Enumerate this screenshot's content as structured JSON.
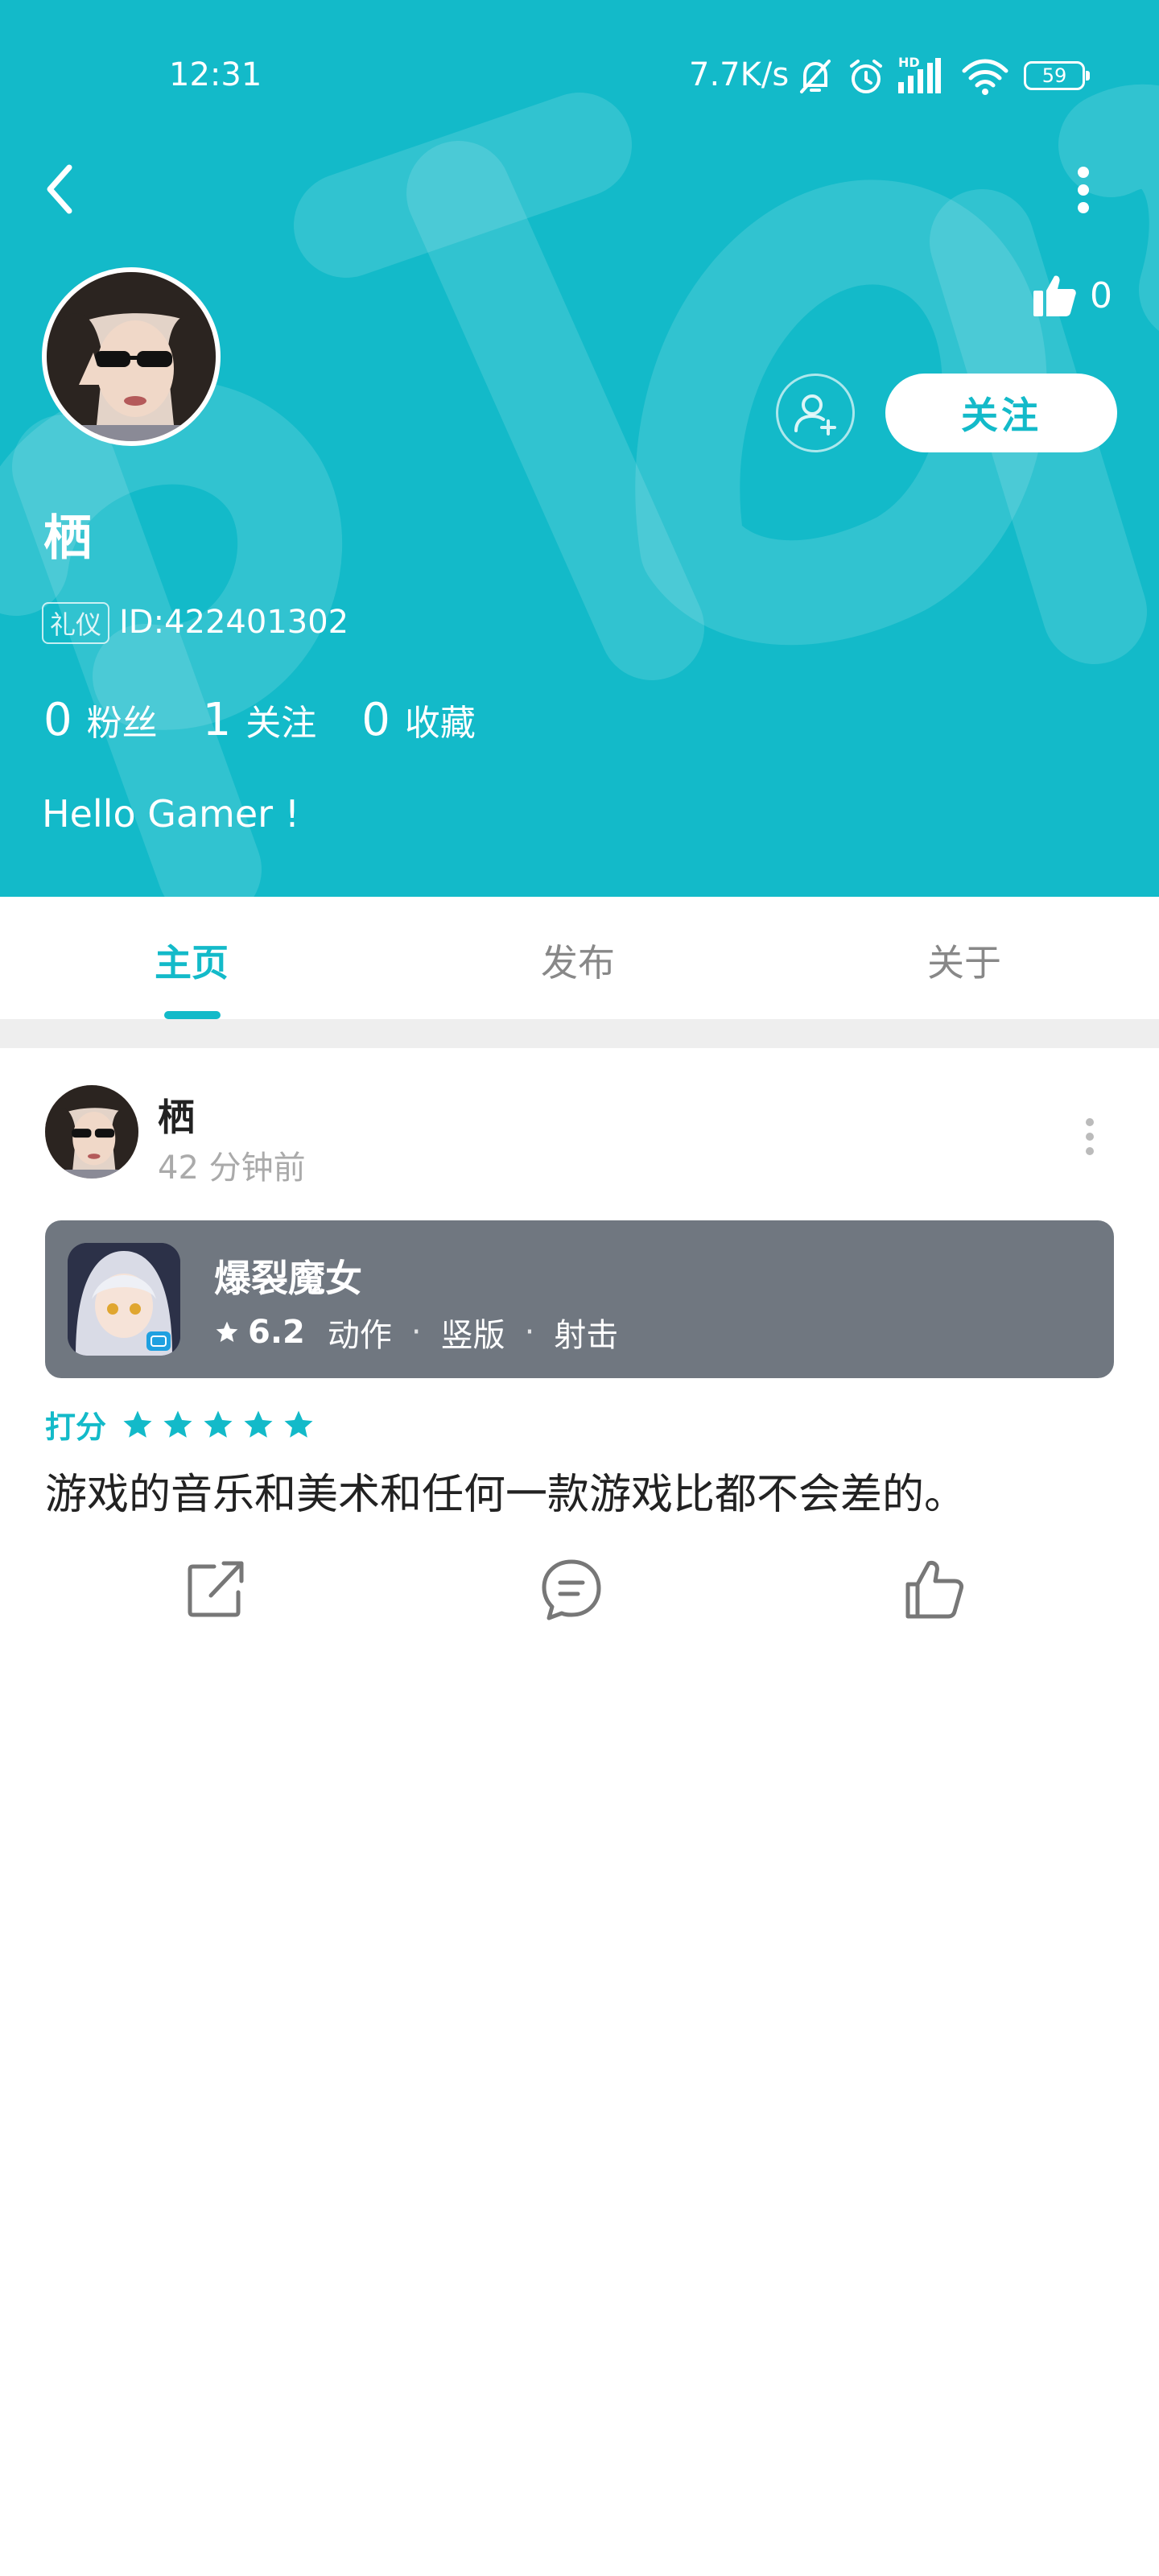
{
  "status_bar": {
    "time": "12:31",
    "net_speed": "7.7K/s",
    "battery": "59",
    "signal_tag": "HD"
  },
  "profile": {
    "name": "栖",
    "badge": "礼仪",
    "id_text": "ID:422401302",
    "likes": "0",
    "follow_label": "关注",
    "stats": [
      {
        "num": "0",
        "label": "粉丝"
      },
      {
        "num": "1",
        "label": "关注"
      },
      {
        "num": "0",
        "label": "收藏"
      }
    ],
    "bio": "Hello Gamer !"
  },
  "tabs": [
    {
      "label": "主页",
      "active": true
    },
    {
      "label": "发布",
      "active": false
    },
    {
      "label": "关于",
      "active": false
    }
  ],
  "post": {
    "author": "栖",
    "time": "42 分钟前",
    "game": {
      "title": "爆裂魔女",
      "score": "6.2",
      "tags": [
        "动作",
        "竖版",
        "射击"
      ]
    },
    "rating_label": "打分",
    "rating_stars": 5,
    "text": "游戏的音乐和美术和任何一款游戏比都不会差的。"
  },
  "colors": {
    "accent": "#13bac9",
    "card_bg": "#707780"
  }
}
